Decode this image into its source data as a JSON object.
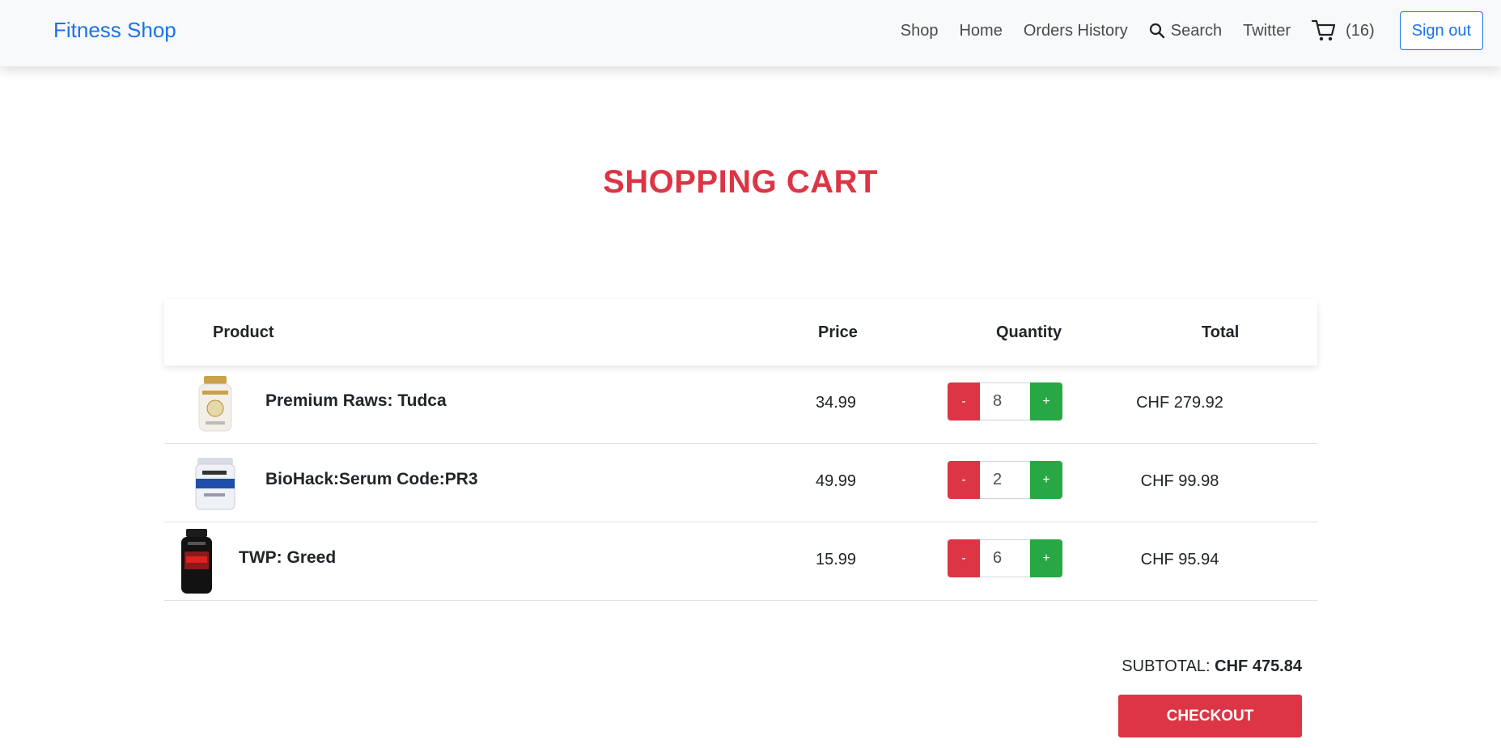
{
  "navbar": {
    "brand": "Fitness Shop",
    "links": {
      "shop": "Shop",
      "home": "Home",
      "orders": "Orders History",
      "search": "Search",
      "twitter": "Twitter"
    },
    "cart_count": "(16)",
    "signout": "Sign out"
  },
  "page": {
    "title": "SHOPPING CART"
  },
  "table": {
    "headers": {
      "product": "Product",
      "price": "Price",
      "quantity": "Quantity",
      "total": "Total"
    },
    "rows": [
      {
        "name": "Premium Raws: Tudca",
        "price": "34.99",
        "quantity": "8",
        "total": "CHF 279.92",
        "image_icon": "supplement-bottle-gold"
      },
      {
        "name": "BioHack:Serum Code:PR3",
        "price": "49.99",
        "quantity": "2",
        "total": "CHF 99.98",
        "image_icon": "supplement-tub-blue"
      },
      {
        "name": "TWP: Greed",
        "price": "15.99",
        "quantity": "6",
        "total": "CHF 95.94",
        "image_icon": "supplement-bottle-black"
      }
    ],
    "minus_label": "-",
    "plus_label": "+"
  },
  "summary": {
    "subtotal_label": "SUBTOTAL:",
    "subtotal_value": "CHF 475.84",
    "checkout": "CHECKOUT"
  },
  "colors": {
    "brand": "#1a73e8",
    "danger": "#dc3545",
    "success": "#28a745"
  }
}
